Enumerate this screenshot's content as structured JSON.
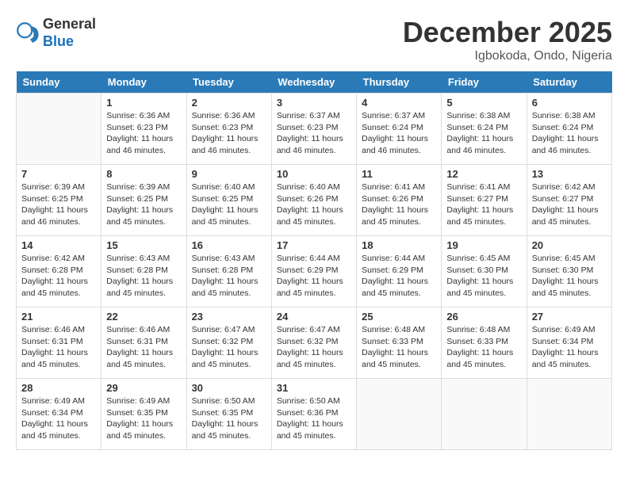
{
  "header": {
    "logo_general": "General",
    "logo_blue": "Blue",
    "month_title": "December 2025",
    "location": "Igbokoda, Ondo, Nigeria"
  },
  "days_of_week": [
    "Sunday",
    "Monday",
    "Tuesday",
    "Wednesday",
    "Thursday",
    "Friday",
    "Saturday"
  ],
  "weeks": [
    [
      {
        "day": "",
        "info": ""
      },
      {
        "day": "1",
        "info": "Sunrise: 6:36 AM\nSunset: 6:23 PM\nDaylight: 11 hours and 46 minutes."
      },
      {
        "day": "2",
        "info": "Sunrise: 6:36 AM\nSunset: 6:23 PM\nDaylight: 11 hours and 46 minutes."
      },
      {
        "day": "3",
        "info": "Sunrise: 6:37 AM\nSunset: 6:23 PM\nDaylight: 11 hours and 46 minutes."
      },
      {
        "day": "4",
        "info": "Sunrise: 6:37 AM\nSunset: 6:24 PM\nDaylight: 11 hours and 46 minutes."
      },
      {
        "day": "5",
        "info": "Sunrise: 6:38 AM\nSunset: 6:24 PM\nDaylight: 11 hours and 46 minutes."
      },
      {
        "day": "6",
        "info": "Sunrise: 6:38 AM\nSunset: 6:24 PM\nDaylight: 11 hours and 46 minutes."
      }
    ],
    [
      {
        "day": "7",
        "info": "Sunrise: 6:39 AM\nSunset: 6:25 PM\nDaylight: 11 hours and 46 minutes."
      },
      {
        "day": "8",
        "info": "Sunrise: 6:39 AM\nSunset: 6:25 PM\nDaylight: 11 hours and 45 minutes."
      },
      {
        "day": "9",
        "info": "Sunrise: 6:40 AM\nSunset: 6:25 PM\nDaylight: 11 hours and 45 minutes."
      },
      {
        "day": "10",
        "info": "Sunrise: 6:40 AM\nSunset: 6:26 PM\nDaylight: 11 hours and 45 minutes."
      },
      {
        "day": "11",
        "info": "Sunrise: 6:41 AM\nSunset: 6:26 PM\nDaylight: 11 hours and 45 minutes."
      },
      {
        "day": "12",
        "info": "Sunrise: 6:41 AM\nSunset: 6:27 PM\nDaylight: 11 hours and 45 minutes."
      },
      {
        "day": "13",
        "info": "Sunrise: 6:42 AM\nSunset: 6:27 PM\nDaylight: 11 hours and 45 minutes."
      }
    ],
    [
      {
        "day": "14",
        "info": "Sunrise: 6:42 AM\nSunset: 6:28 PM\nDaylight: 11 hours and 45 minutes."
      },
      {
        "day": "15",
        "info": "Sunrise: 6:43 AM\nSunset: 6:28 PM\nDaylight: 11 hours and 45 minutes."
      },
      {
        "day": "16",
        "info": "Sunrise: 6:43 AM\nSunset: 6:28 PM\nDaylight: 11 hours and 45 minutes."
      },
      {
        "day": "17",
        "info": "Sunrise: 6:44 AM\nSunset: 6:29 PM\nDaylight: 11 hours and 45 minutes."
      },
      {
        "day": "18",
        "info": "Sunrise: 6:44 AM\nSunset: 6:29 PM\nDaylight: 11 hours and 45 minutes."
      },
      {
        "day": "19",
        "info": "Sunrise: 6:45 AM\nSunset: 6:30 PM\nDaylight: 11 hours and 45 minutes."
      },
      {
        "day": "20",
        "info": "Sunrise: 6:45 AM\nSunset: 6:30 PM\nDaylight: 11 hours and 45 minutes."
      }
    ],
    [
      {
        "day": "21",
        "info": "Sunrise: 6:46 AM\nSunset: 6:31 PM\nDaylight: 11 hours and 45 minutes."
      },
      {
        "day": "22",
        "info": "Sunrise: 6:46 AM\nSunset: 6:31 PM\nDaylight: 11 hours and 45 minutes."
      },
      {
        "day": "23",
        "info": "Sunrise: 6:47 AM\nSunset: 6:32 PM\nDaylight: 11 hours and 45 minutes."
      },
      {
        "day": "24",
        "info": "Sunrise: 6:47 AM\nSunset: 6:32 PM\nDaylight: 11 hours and 45 minutes."
      },
      {
        "day": "25",
        "info": "Sunrise: 6:48 AM\nSunset: 6:33 PM\nDaylight: 11 hours and 45 minutes."
      },
      {
        "day": "26",
        "info": "Sunrise: 6:48 AM\nSunset: 6:33 PM\nDaylight: 11 hours and 45 minutes."
      },
      {
        "day": "27",
        "info": "Sunrise: 6:49 AM\nSunset: 6:34 PM\nDaylight: 11 hours and 45 minutes."
      }
    ],
    [
      {
        "day": "28",
        "info": "Sunrise: 6:49 AM\nSunset: 6:34 PM\nDaylight: 11 hours and 45 minutes."
      },
      {
        "day": "29",
        "info": "Sunrise: 6:49 AM\nSunset: 6:35 PM\nDaylight: 11 hours and 45 minutes."
      },
      {
        "day": "30",
        "info": "Sunrise: 6:50 AM\nSunset: 6:35 PM\nDaylight: 11 hours and 45 minutes."
      },
      {
        "day": "31",
        "info": "Sunrise: 6:50 AM\nSunset: 6:36 PM\nDaylight: 11 hours and 45 minutes."
      },
      {
        "day": "",
        "info": ""
      },
      {
        "day": "",
        "info": ""
      },
      {
        "day": "",
        "info": ""
      }
    ]
  ]
}
